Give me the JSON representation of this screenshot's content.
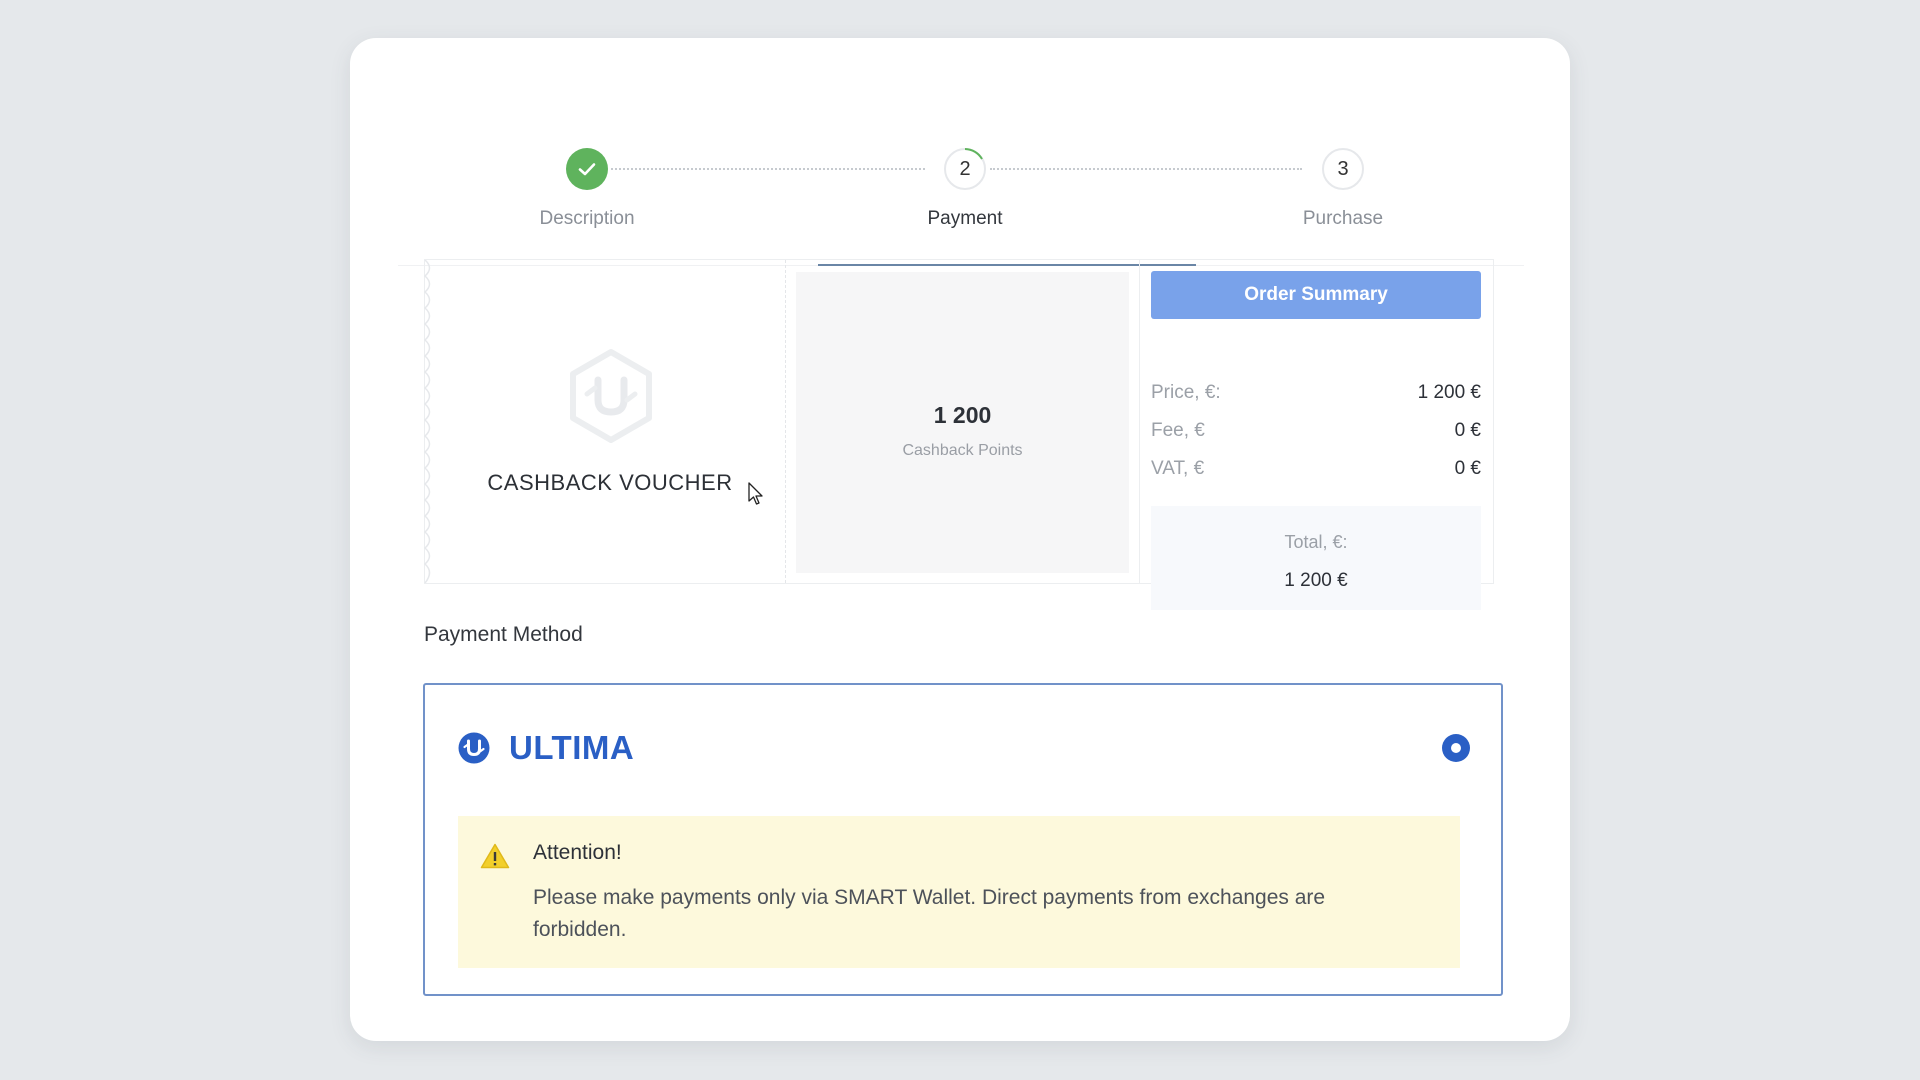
{
  "stepper": {
    "steps": [
      {
        "number": "1",
        "label": "Description",
        "state": "completed"
      },
      {
        "number": "2",
        "label": "Payment",
        "state": "active"
      },
      {
        "number": "3",
        "label": "Purchase",
        "state": "pending"
      }
    ]
  },
  "voucher": {
    "title": "CASHBACK VOUCHER",
    "points_value": "1 200",
    "points_label": "Cashback Points"
  },
  "order_summary": {
    "button_label": "Order Summary",
    "rows": [
      {
        "label": "Price, €:",
        "value": "1 200 €"
      },
      {
        "label": "Fee, €",
        "value": "0 €"
      },
      {
        "label": "VAT, €",
        "value": "0 €"
      }
    ],
    "total_label": "Total, €:",
    "total_value": "1 200 €"
  },
  "payment_method": {
    "title": "Payment Method",
    "option": {
      "brand": "ULTIMA",
      "selected": true
    },
    "alert": {
      "title": "Attention!",
      "text": "Please make payments only via SMART Wallet. Direct payments from exchanges are forbidden."
    }
  },
  "colors": {
    "completed_green": "#5fb35d",
    "accent_blue": "#2a5fc5",
    "summary_button": "#79a2ea",
    "alert_background": "#fdf9dc"
  },
  "icons": [
    "check-icon",
    "ultima-logo-icon",
    "warning-icon",
    "cursor-icon"
  ]
}
